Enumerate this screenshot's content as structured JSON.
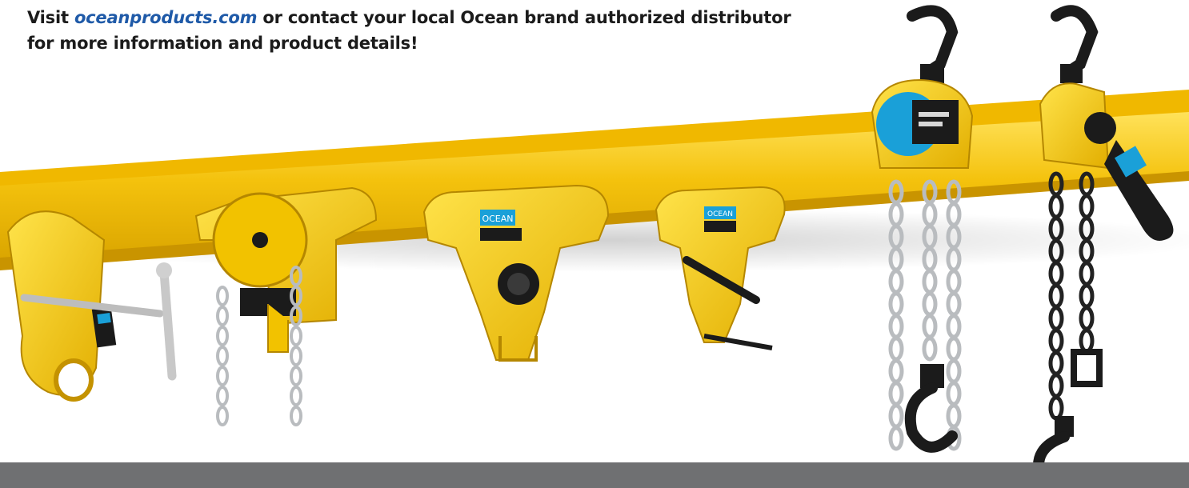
{
  "headline": {
    "prefix": "Visit ",
    "site": "oceanproducts.com",
    "line1_rest": " or contact your local Ocean brand authorized distributor",
    "line2": "for more information and product details!"
  },
  "brand": {
    "label": "OCEAN",
    "yellow": "#f4c20d",
    "yellow_shade": "#d8a300",
    "label_blue": "#1aa0d8",
    "chain_silver": "#b9bcbf",
    "band_gray": "#6f7072"
  },
  "products": [
    {
      "name": "beam-clamp",
      "icon": "beam-clamp-icon"
    },
    {
      "name": "geared-trolley",
      "icon": "geared-trolley-icon"
    },
    {
      "name": "plain-trolley-large",
      "icon": "plain-trolley-icon"
    },
    {
      "name": "plain-trolley-small",
      "icon": "plain-trolley-icon"
    },
    {
      "name": "chain-hoist",
      "icon": "chain-hoist-icon"
    },
    {
      "name": "lever-hoist",
      "icon": "lever-hoist-icon"
    }
  ]
}
